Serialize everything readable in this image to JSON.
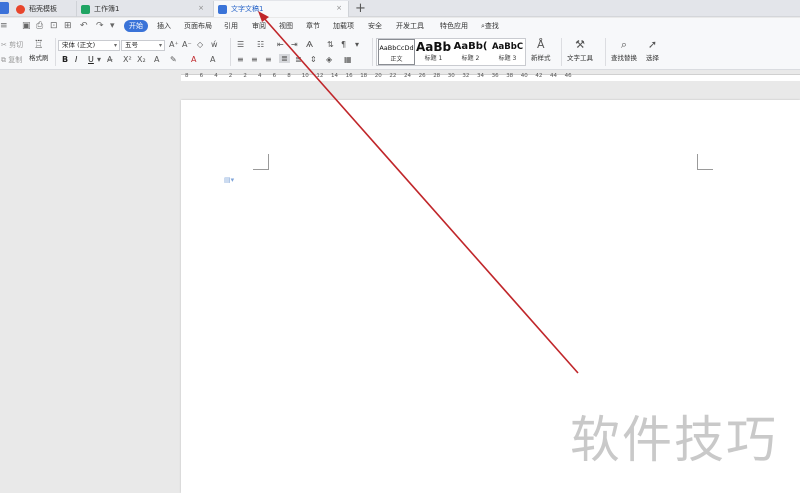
{
  "tabs": [
    {
      "label": "稻壳模板",
      "icon_color": "#e8452c"
    },
    {
      "label": "工作簿1",
      "icon_color": "#1fa463"
    },
    {
      "label": "文字文稿1",
      "icon_color": "#3a73d8"
    }
  ],
  "menu": {
    "items": [
      "开始",
      "插入",
      "页面布局",
      "引用",
      "审阅",
      "视图",
      "章节",
      "加载项",
      "安全",
      "开发工具",
      "特色应用",
      "查找"
    ]
  },
  "ribbon": {
    "cut": "剪切",
    "copy": "复制",
    "format_painter": "格式刷",
    "font_name": "宋体 (正文)",
    "font_size": "五号",
    "styles": [
      {
        "sample": "AaBbCcDd",
        "caption": "正文"
      },
      {
        "sample": "AaBb",
        "caption": "标题 1"
      },
      {
        "sample": "AaBb(",
        "caption": "标题 2"
      },
      {
        "sample": "AaBbC",
        "caption": "标题 3"
      }
    ],
    "new_style": "新样式",
    "text_tools": "文字工具",
    "find_replace": "查找替换",
    "select": "选择"
  },
  "ruler": {
    "labels": [
      "8",
      "6",
      "4",
      "2",
      "2",
      "4",
      "6",
      "8",
      "10",
      "12",
      "14",
      "16",
      "18",
      "20",
      "22",
      "24",
      "26",
      "28",
      "30",
      "32",
      "34",
      "36",
      "38",
      "40",
      "42",
      "44",
      "46"
    ]
  },
  "watermark": "软件技巧",
  "colors": {
    "accent": "#3a73d8",
    "arrow": "#c0262a"
  }
}
